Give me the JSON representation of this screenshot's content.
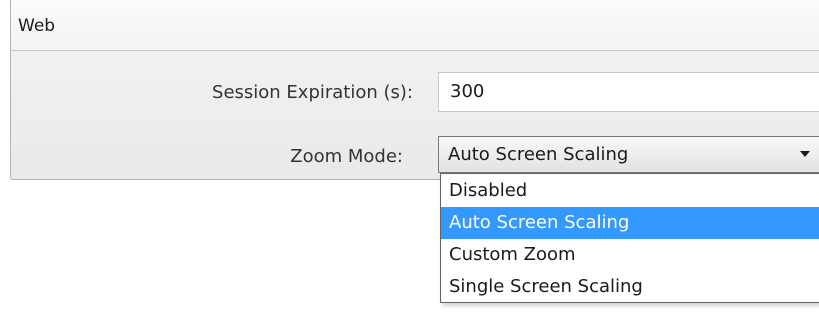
{
  "group": {
    "title": "Web"
  },
  "fields": {
    "session_expiration": {
      "label": "Session Expiration (s):",
      "value": "300"
    },
    "zoom_mode": {
      "label": "Zoom Mode:",
      "selected": "Auto Screen Scaling",
      "expanded": true,
      "options": [
        "Disabled",
        "Auto Screen Scaling",
        "Custom Zoom",
        "Single Screen Scaling"
      ],
      "highlighted_index": 1
    }
  },
  "colors": {
    "highlight": "#3399ff",
    "highlight_text": "#ffffff"
  }
}
